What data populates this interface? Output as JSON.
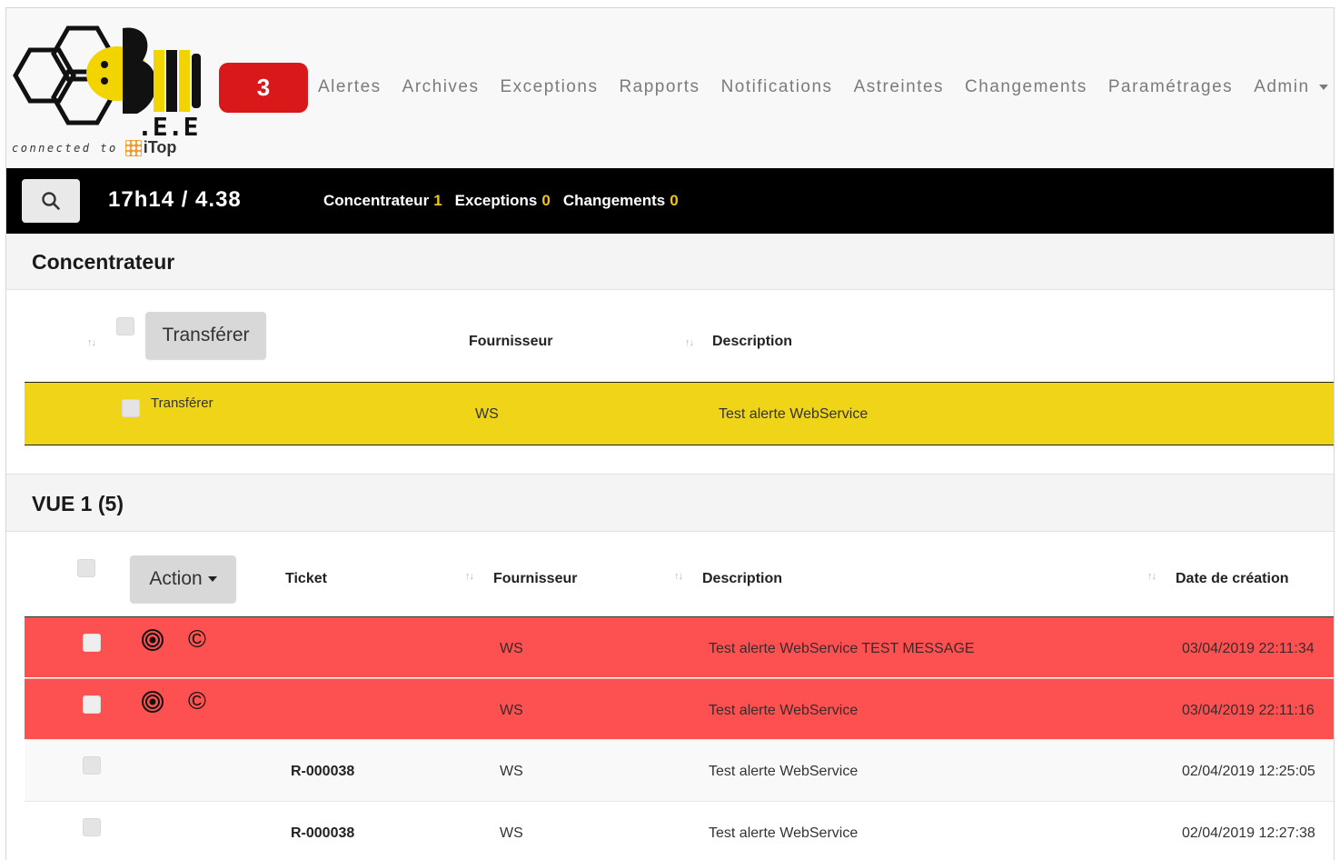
{
  "brand": {
    "caption": "connected to",
    "itop": "iTop",
    "logo_text": ".E.E"
  },
  "nav": {
    "alert_count": "3",
    "items": [
      "Alertes",
      "Archives",
      "Exceptions",
      "Rapports",
      "Notifications",
      "Astreintes",
      "Changements",
      "Paramétrages",
      "Admin"
    ]
  },
  "statusbar": {
    "clock": "17h14 / 4.38",
    "counters": [
      {
        "label": "Concentrateur",
        "value": "1"
      },
      {
        "label": "Exceptions",
        "value": "0"
      },
      {
        "label": "Changements",
        "value": "0"
      }
    ]
  },
  "concentrateur": {
    "title": "Concentrateur",
    "transfer_button": "Transférer",
    "headers": {
      "fournisseur": "Fournisseur",
      "description": "Description"
    },
    "rows": [
      {
        "action": "Transférer",
        "fournisseur": "WS",
        "description": "Test alerte WebService"
      }
    ]
  },
  "vue": {
    "title": "VUE 1 (5)",
    "action_button": "Action",
    "headers": {
      "ticket": "Ticket",
      "fournisseur": "Fournisseur",
      "description": "Description",
      "date": "Date de création"
    },
    "rows": [
      {
        "ticket": "",
        "fournisseur": "WS",
        "description": "Test alerte WebService TEST MESSAGE",
        "date": "03/04/2019 22:11:34",
        "status": "alert"
      },
      {
        "ticket": "",
        "fournisseur": "WS",
        "description": "Test alerte WebService",
        "date": "03/04/2019 22:11:16",
        "status": "alert"
      },
      {
        "ticket": "R-000038",
        "fournisseur": "WS",
        "description": "Test alerte WebService",
        "date": "02/04/2019 12:25:05",
        "status": "normal"
      },
      {
        "ticket": "R-000038",
        "fournisseur": "WS",
        "description": "Test alerte WebService",
        "date": "02/04/2019 12:27:38",
        "status": "normal"
      }
    ]
  },
  "colors": {
    "alert_row": "#fd5151",
    "highlight_row": "#efd417",
    "badge": "#d9181a",
    "counter": "#f0c419"
  },
  "icons": {
    "search": "search-icon",
    "target": "target-icon",
    "copyright": "copyright-icon"
  }
}
